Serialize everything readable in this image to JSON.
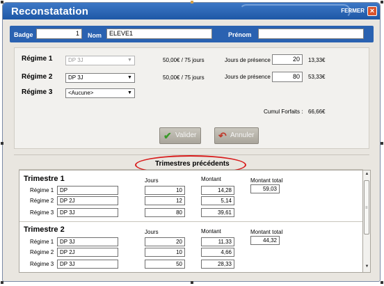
{
  "window": {
    "title": "Reconstatation",
    "close_label": "FERMER",
    "close_icon": "close-icon"
  },
  "ident": {
    "badge_label": "Badge",
    "badge_value": "1",
    "nom_label": "Nom",
    "nom_value": "ELEVE1",
    "prenom_label": "Prénom",
    "prenom_value": ""
  },
  "regimes": [
    {
      "label": "Régime 1",
      "value": "DP 3J",
      "disabled": true,
      "price": "50,00€ / 75 jours",
      "jours_label": "Jours de présence",
      "jours": "20",
      "montant": "13,33€"
    },
    {
      "label": "Régime 2",
      "value": "DP 3J",
      "disabled": false,
      "price": "50,00€ / 75 jours",
      "jours_label": "Jours de présence",
      "jours": "80",
      "montant": "53,33€"
    },
    {
      "label": "Régime 3",
      "value": "<Aucune>",
      "disabled": false
    }
  ],
  "cumul": {
    "label": "Cumul Forfaits :",
    "value": "66,66€"
  },
  "buttons": {
    "valider": "Valider",
    "annuler": "Annuler"
  },
  "previous": {
    "title": "Trimestres précédents",
    "col_jours": "Jours",
    "col_montant": "Montant",
    "col_total": "Montant total",
    "trimestres": [
      {
        "label": "Trimestre",
        "number": "1",
        "total": "59,03",
        "rows": [
          {
            "label": "Régime 1",
            "regime": "DP",
            "jours": "10",
            "montant": "14,28"
          },
          {
            "label": "Régime 2",
            "regime": "DP 2J",
            "jours": "12",
            "montant": "5,14"
          },
          {
            "label": "Régime 3",
            "regime": "DP 3J",
            "jours": "80",
            "montant": "39,61"
          }
        ]
      },
      {
        "label": "Trimestre",
        "number": "2",
        "total": "44,32",
        "rows": [
          {
            "label": "Régime 1",
            "regime": "DP 3J",
            "jours": "20",
            "montant": "11,33"
          },
          {
            "label": "Régime 2",
            "regime": "DP 2J",
            "jours": "10",
            "montant": "4,66"
          },
          {
            "label": "Régime 3",
            "regime": "DP 3J",
            "jours": "50",
            "montant": "28,33"
          }
        ]
      }
    ]
  },
  "colors": {
    "title_bar": "#2a62b1",
    "annotation_circle": "#d81b1b",
    "valider_check": "#3a9a2a",
    "annuler_arrow": "#c0392b"
  }
}
